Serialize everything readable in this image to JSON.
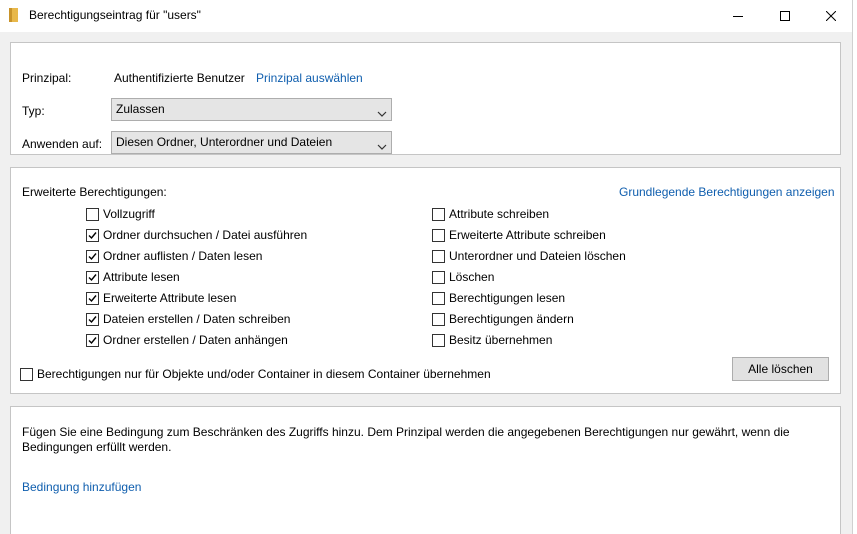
{
  "window": {
    "title": "Berechtigungseintrag für \"users\"",
    "folder_icon_color": "#e8b84a",
    "controls": [
      "minimize-icon",
      "maximize-icon",
      "close-icon"
    ]
  },
  "principal_section": {
    "principal_label": "Prinzipal:",
    "principal_value": "Authentifizierte Benutzer",
    "select_principal_link": "Prinzipal auswählen",
    "type_label": "Typ:",
    "type_value": "Zulassen",
    "apply_to_label": "Anwenden auf:",
    "apply_to_value": "Diesen Ordner, Unterordner und Dateien"
  },
  "permissions_section": {
    "heading": "Erweiterte Berechtigungen:",
    "basic_permissions_link": "Grundlegende Berechtigungen anzeigen",
    "left_column": [
      {
        "label": "Vollzugriff",
        "checked": false
      },
      {
        "label": "Ordner durchsuchen / Datei ausführen",
        "checked": true
      },
      {
        "label": "Ordner auflisten / Daten lesen",
        "checked": true
      },
      {
        "label": "Attribute lesen",
        "checked": true
      },
      {
        "label": "Erweiterte Attribute lesen",
        "checked": true
      },
      {
        "label": "Dateien erstellen / Daten schreiben",
        "checked": true
      },
      {
        "label": "Ordner erstellen / Daten anhängen",
        "checked": true
      }
    ],
    "right_column": [
      {
        "label": "Attribute schreiben",
        "checked": false
      },
      {
        "label": "Erweiterte Attribute schreiben",
        "checked": false
      },
      {
        "label": "Unterordner und Dateien löschen",
        "checked": false
      },
      {
        "label": "Löschen",
        "checked": false
      },
      {
        "label": "Berechtigungen lesen",
        "checked": false
      },
      {
        "label": "Berechtigungen ändern",
        "checked": false
      },
      {
        "label": "Besitz übernehmen",
        "checked": false
      }
    ],
    "inherit_only_label": "Berechtigungen nur für Objekte und/oder Container in diesem Container übernehmen",
    "inherit_only_checked": false,
    "clear_all_button": "Alle löschen"
  },
  "condition_section": {
    "description": "Fügen Sie eine Bedingung zum Beschränken des Zugriffs hinzu. Dem Prinzipal werden die angegebenen Berechtigungen nur gewährt, wenn die",
    "description_line2": "Bedingungen erfüllt werden.",
    "add_condition_link": "Bedingung hinzufügen"
  },
  "colors": {
    "link": "#0f5eae",
    "panel_border": "#c5c5c5",
    "background": "#f0f0f0"
  }
}
